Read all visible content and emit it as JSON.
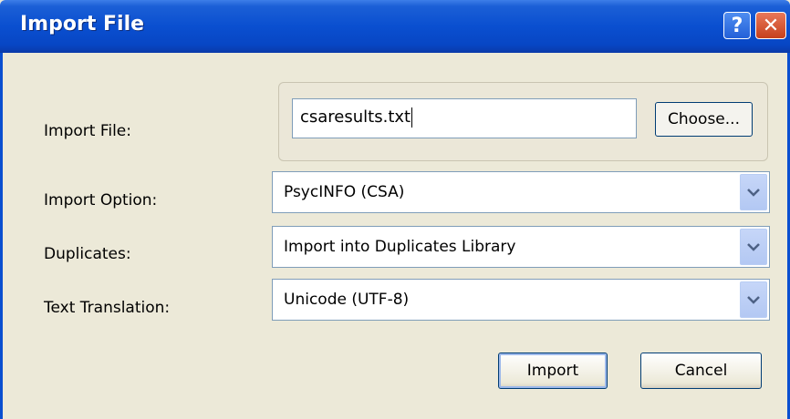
{
  "window": {
    "title": "Import File"
  },
  "titlebar": {
    "help_label": "?",
    "close_label": "✕"
  },
  "form": {
    "import_file": {
      "label": "Import File:",
      "value": "csaresults.txt",
      "choose_label": "Choose..."
    },
    "import_option": {
      "label": "Import Option:",
      "value": "PsycINFO (CSA)"
    },
    "duplicates": {
      "label": "Duplicates:",
      "value": "Import into Duplicates Library"
    },
    "text_translation": {
      "label": "Text Translation:",
      "value": "Unicode (UTF-8)"
    }
  },
  "buttons": {
    "import_label": "Import",
    "cancel_label": "Cancel"
  },
  "icons": {
    "help": "help-icon",
    "close": "close-icon",
    "dropdown": "chevron-down-icon"
  },
  "colors": {
    "titlebar": "#0a4fd0",
    "dialog_bg": "#ece9d8",
    "close_button": "#c6401c"
  }
}
